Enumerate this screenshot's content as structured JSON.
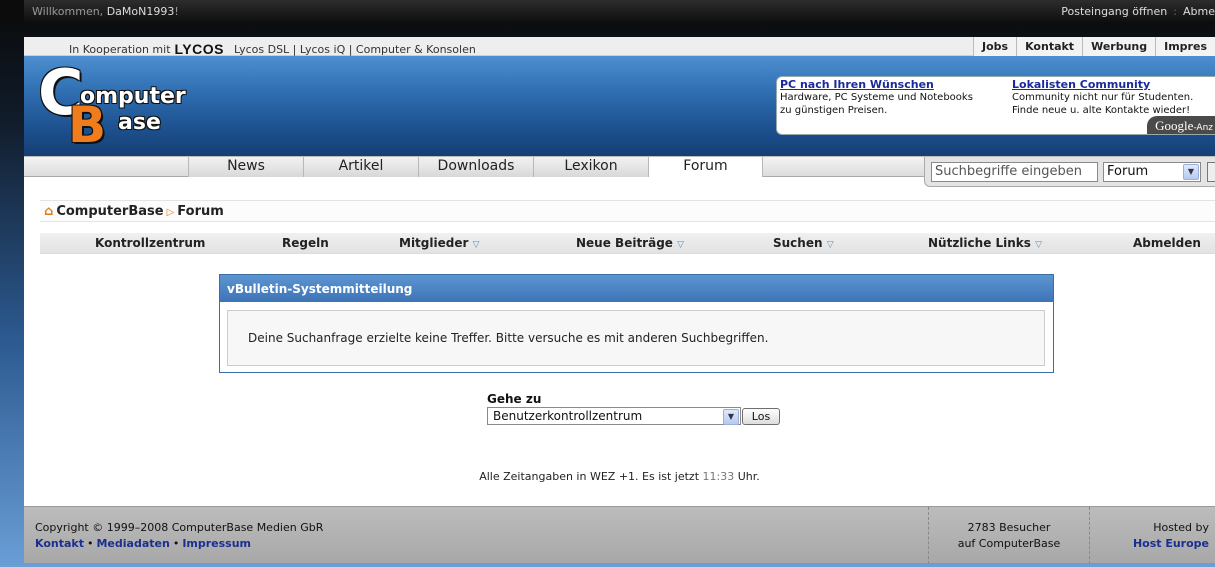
{
  "topbar": {
    "welcome_prefix": "Willkommen,",
    "username": "DaMoN1993",
    "welcome_suffix": "!",
    "inbox_link": "Posteingang öffnen",
    "logout_link": "Abme"
  },
  "coop": {
    "prefix": "In Kooperation mit",
    "brand": "LYCOS",
    "links": "Lycos DSL | Lycos iQ | Computer & Konsolen",
    "right_links": [
      "Jobs",
      "Kontakt",
      "Werbung",
      "Impres"
    ]
  },
  "logo": {
    "c": "C",
    "b": "B",
    "word1": "omputer",
    "word2": "ase"
  },
  "ads": [
    {
      "title": "PC nach Ihren Wünschen",
      "line1": "Hardware, PC Systeme und Notebooks",
      "line2": "zu günstigen Preisen."
    },
    {
      "title": "Lokalisten Community",
      "line1": "Community nicht nur für Studenten.",
      "line2": "Finde neue u. alte Kontakte wieder!"
    }
  ],
  "google_badge": {
    "brand": "Google",
    "suffix": "-Anz"
  },
  "nav": {
    "tabs": [
      "News",
      "Artikel",
      "Downloads",
      "Lexikon",
      "Forum"
    ],
    "active": "Forum"
  },
  "search": {
    "placeholder": "Suchbegriffe eingeben",
    "scope": "Forum"
  },
  "breadcrumb": {
    "root": "ComputerBase",
    "current": "Forum"
  },
  "menubar": {
    "items": [
      "Kontrollzentrum",
      "Regeln",
      "Mitglieder",
      "Neue Beiträge",
      "Suchen",
      "Nützliche Links",
      "Abmelden"
    ]
  },
  "system_message": {
    "title": "vBulletin-Systemmitteilung",
    "text": "Deine Suchanfrage erzielte keine Treffer. Bitte versuche es mit anderen Suchbegriffen."
  },
  "goto": {
    "label": "Gehe zu",
    "selected": "Benutzerkontrollzentrum",
    "button": "Los"
  },
  "timeinfo": {
    "prefix": "Alle Zeitangaben in WEZ +1. Es ist jetzt",
    "time": "11:33",
    "suffix": "Uhr."
  },
  "footer": {
    "copyright": "Copyright © 1999–2008 ComputerBase Medien GbR",
    "links": [
      "Kontakt",
      "Mediadaten",
      "Impressum"
    ],
    "visitors_line1": "2783 Besucher",
    "visitors_line2": "auf ComputerBase",
    "hosted_label": "Hosted by",
    "host": "Host Europe"
  },
  "colors": {
    "header_blue": "#2f6fb2",
    "accent_orange": "#f07d1c",
    "link_blue": "#1a2f8f"
  }
}
